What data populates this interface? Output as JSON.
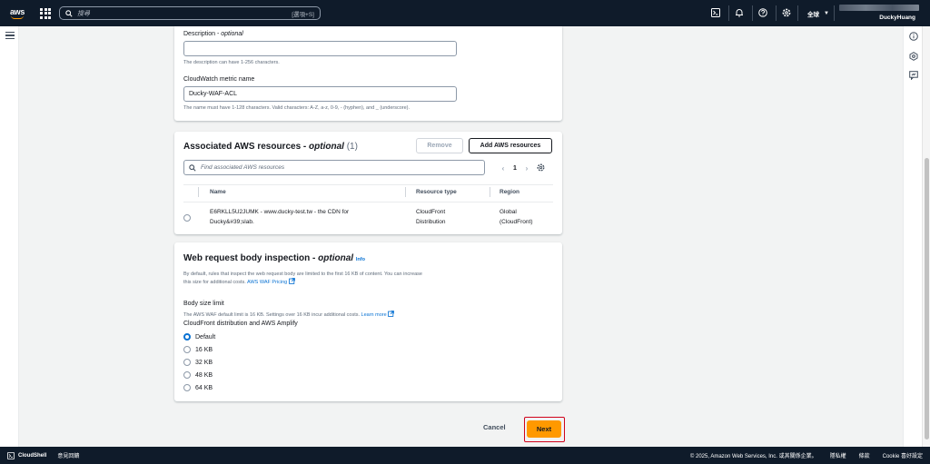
{
  "nav": {
    "logo_text": "aws",
    "search_placeholder": "搜尋",
    "search_shortcut": "[選項+S]",
    "region_label": "全球",
    "username": "DuckyHuang"
  },
  "form": {
    "description_label": "Description",
    "description_optional": "optional",
    "description_value": "",
    "description_hint": "The description can have 1-256 characters.",
    "metric_label": "CloudWatch metric name",
    "metric_value": "Ducky-WAF-ACL",
    "metric_hint": "The name must have 1-128 characters. Valid characters: A-Z, a-z, 0-9, - (hyphen), and _ (underscore)."
  },
  "resources": {
    "title": "Associated AWS resources",
    "title_optional": "optional",
    "count": "(1)",
    "remove_label": "Remove",
    "add_label": "Add AWS resources",
    "search_placeholder": "Find associated AWS resources",
    "page": "1",
    "columns": [
      "Name",
      "Resource type",
      "Region"
    ],
    "rows": [
      {
        "name_line1": "E6RKLL5U2JUMK - www.ducky-test.tw - the CDN for",
        "name_line2": "Ducky&#39;slab.",
        "type_line1": "CloudFront",
        "type_line2": "Distribution",
        "region_line1": "Global",
        "region_line2": "(CloudFront)"
      }
    ]
  },
  "body_inspection": {
    "title": "Web request body inspection",
    "title_optional": "optional",
    "info": "Info",
    "desc_line1": "By default, rules that inspect the web request body are limited to the first 16 KB of content. You can increase",
    "desc_line2": "this size for additional costs.",
    "pricing_link": "AWS WAF Pricing",
    "size_label": "Body size limit",
    "size_hint": "The AWS WAF default limit is 16 KB. Settings over 16 KB incur additional costs.",
    "learn_more": "Learn more",
    "group_label": "CloudFront distribution and AWS Amplify",
    "options": [
      "Default",
      "16 KB",
      "32 KB",
      "48 KB",
      "64 KB"
    ],
    "selected": "Default"
  },
  "actions": {
    "cancel": "Cancel",
    "next": "Next"
  },
  "footer": {
    "cloudshell": "CloudShell",
    "feedback": "意見回饋",
    "copyright": "© 2025, Amazon Web Services, Inc. 或其關係企業。",
    "privacy": "隱私權",
    "terms": "條款",
    "cookie": "Cookie 喜好設定"
  },
  "colors": {
    "nav_bg": "#0f1b2a",
    "primary": "#ff9900",
    "link": "#0972d3",
    "highlight_border": "#d0021b"
  }
}
